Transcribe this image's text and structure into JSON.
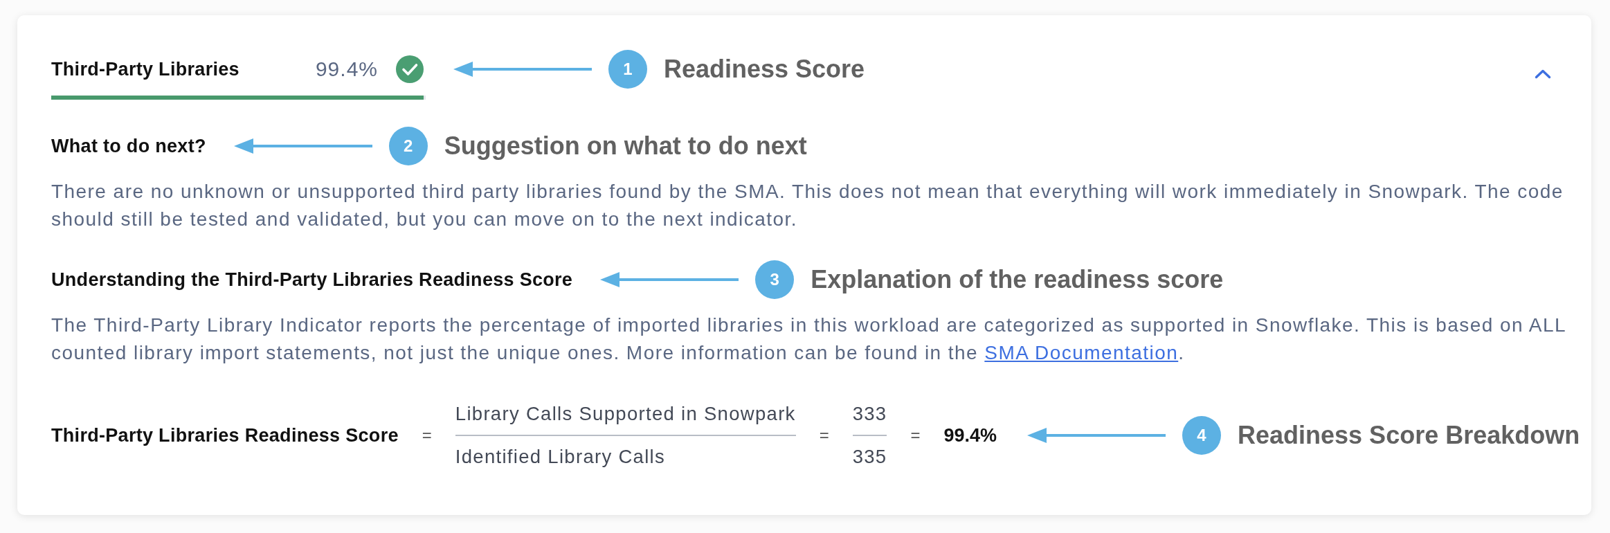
{
  "panel": {
    "title": "Third-Party Libraries",
    "score": "99.4%",
    "level": 0.994,
    "expanded": true,
    "annotation": {
      "number": "1",
      "label": "Readiness Score"
    }
  },
  "sections": [
    {
      "heading": "What to do next?",
      "annotation": {
        "number": "2",
        "label": "Suggestion on what to do next"
      },
      "body": [
        {
          "kind": "text",
          "text": "There are no unknown or unsupported third party libraries found by the SMA. This does not mean that everything will work immediately in Snowpark. The code should still be tested and validated, but you can move on to the next indicator."
        }
      ]
    },
    {
      "heading": "Understanding the Third-Party Libraries Readiness Score",
      "annotation": {
        "number": "3",
        "label": "Explanation of the readiness score"
      },
      "body": [
        {
          "kind": "text",
          "text": "The Third-Party Library Indicator reports the percentage of imported libraries in this workload are categorized as supported in Snowflake. This is based on ALL counted library import statements, not just the unique ones. More information can be found in the "
        },
        {
          "kind": "link",
          "text": "SMA Documentation"
        },
        {
          "kind": "text",
          "text": "."
        }
      ]
    }
  ],
  "formula": {
    "terms": [
      {
        "kind": "label",
        "text": "Third-Party Libraries Readiness Score"
      },
      {
        "kind": "operator",
        "text": "="
      },
      {
        "kind": "fraction",
        "numerator": "Library Calls Supported in Snowpark",
        "denominator": "Identified Library Calls"
      },
      {
        "kind": "operator",
        "text": "="
      },
      {
        "kind": "fraction",
        "numerator": "333",
        "denominator": "335"
      },
      {
        "kind": "operator",
        "text": "="
      },
      {
        "kind": "result",
        "text": "99.4%"
      }
    ],
    "annotation": {
      "number": "4",
      "label": "Readiness Score Breakdown"
    }
  }
}
